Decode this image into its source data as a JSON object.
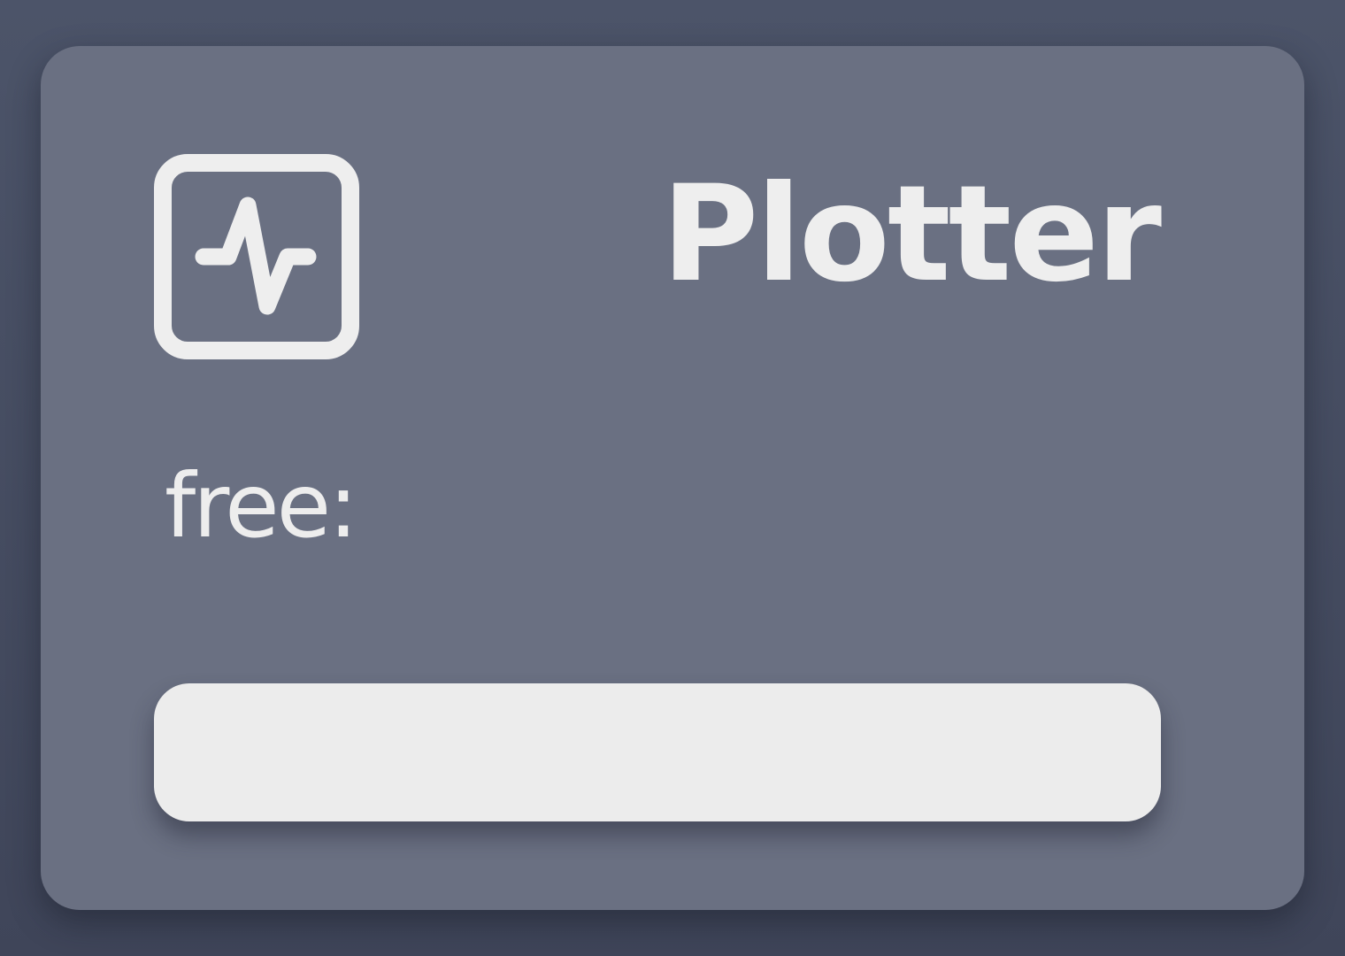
{
  "app": {
    "title": "Plotter",
    "icon": "activity-pulse-icon"
  },
  "status": {
    "free_label": "free:",
    "free_value": ""
  },
  "action": {
    "button_label": ""
  },
  "colors": {
    "background": "#4c5469",
    "card": "#6a7082",
    "foreground": "#eeeeee",
    "button": "#ececec"
  }
}
